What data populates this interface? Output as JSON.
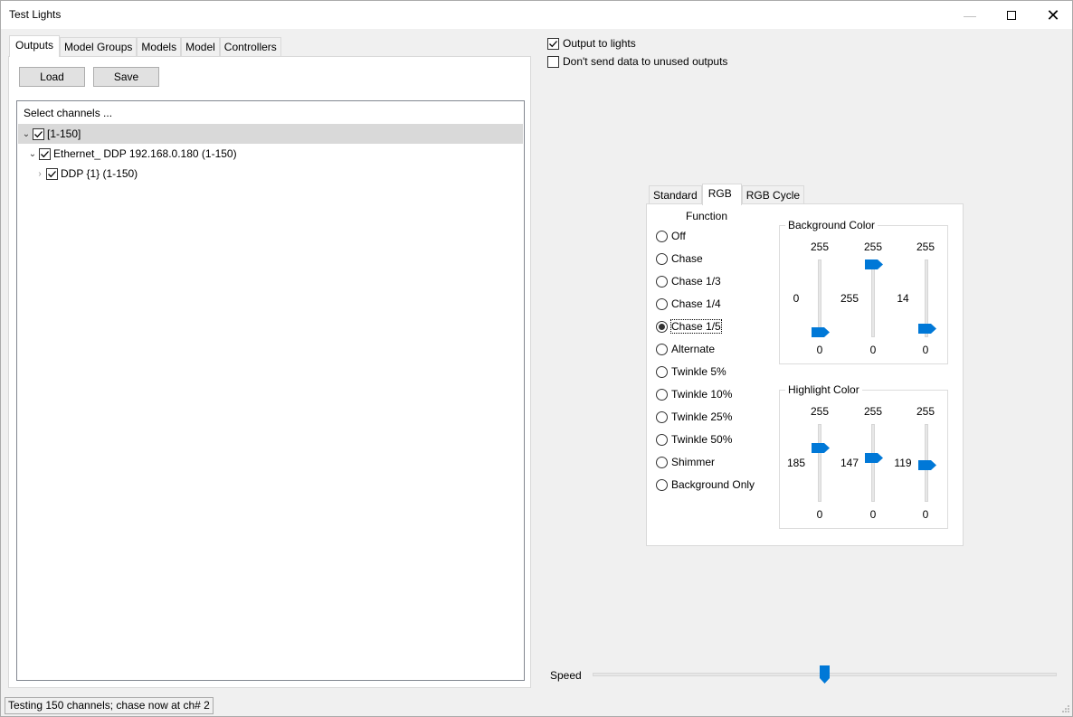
{
  "window": {
    "title": "Test Lights"
  },
  "left_tabs": [
    "Outputs",
    "Model Groups",
    "Models",
    "Model",
    "Controllers"
  ],
  "buttons": {
    "load": "Load",
    "save": "Save"
  },
  "tree": {
    "header": "Select channels ...",
    "rows": [
      {
        "label": "[1-150]",
        "checked": true,
        "expanded": true
      },
      {
        "label": "Ethernet_ DDP 192.168.0.180 (1-150)",
        "checked": true,
        "expanded": true
      },
      {
        "label": "DDP {1} (1-150)",
        "checked": true,
        "expanded": false
      }
    ]
  },
  "options": {
    "output_to_lights": "Output to lights",
    "dont_send_unused": "Don't send data to unused outputs"
  },
  "right_tabs": [
    "Standard",
    "RGB",
    "RGB Cycle"
  ],
  "function": {
    "title": "Function",
    "items": [
      "Off",
      "Chase",
      "Chase 1/3",
      "Chase 1/4",
      "Chase 1/5",
      "Alternate",
      "Twinkle 5%",
      "Twinkle 10%",
      "Twinkle 25%",
      "Twinkle 50%",
      "Shimmer",
      "Background Only"
    ],
    "selected": "Chase 1/5"
  },
  "background_color": {
    "title": "Background Color",
    "max_labels": [
      "255",
      "255",
      "255"
    ],
    "min_labels": [
      "0",
      "0",
      "0"
    ],
    "values": [
      "0",
      "255",
      "14"
    ],
    "levels": [
      0,
      255,
      14
    ]
  },
  "highlight_color": {
    "title": "Highlight Color",
    "max_labels": [
      "255",
      "255",
      "255"
    ],
    "min_labels": [
      "0",
      "0",
      "0"
    ],
    "values": [
      "185",
      "147",
      "119"
    ],
    "levels": [
      185,
      147,
      119
    ]
  },
  "speed": {
    "label": "Speed",
    "level_fraction": 0.5
  },
  "status": "Testing 150 channels; chase now at ch# 2",
  "colors": {
    "accent": "#0078d7",
    "selected_row": "#d9d9d9"
  }
}
